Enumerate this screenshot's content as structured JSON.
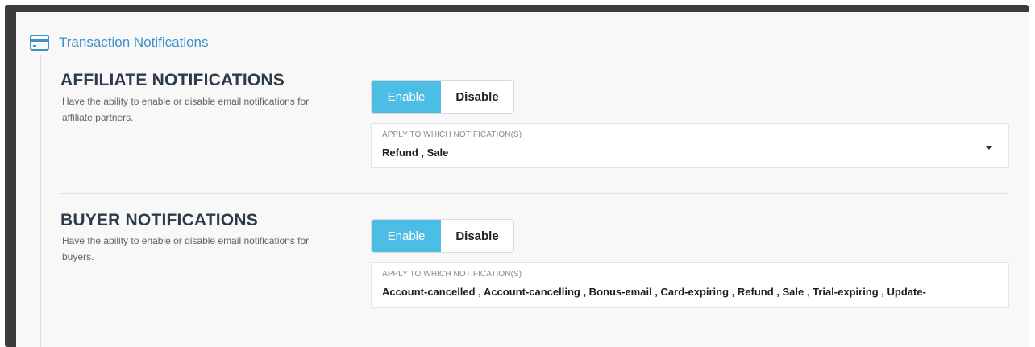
{
  "header": {
    "title": "Transaction Notifications",
    "icon": "credit-card-icon",
    "accent_color": "#3d92c9"
  },
  "sections": [
    {
      "title": "AFFILIATE NOTIFICATIONS",
      "description": "Have the ability to enable or disable email notifications for affiliate partners.",
      "toggle": {
        "enable_label": "Enable",
        "disable_label": "Disable",
        "selected": "Enable"
      },
      "select": {
        "label": "APPLY TO WHICH NOTIFICATION(S)",
        "value": "Refund , Sale"
      }
    },
    {
      "title": "BUYER NOTIFICATIONS",
      "description": "Have the ability to enable or disable email notifications for buyers.",
      "toggle": {
        "enable_label": "Enable",
        "disable_label": "Disable",
        "selected": "Enable"
      },
      "select": {
        "label": "APPLY TO WHICH NOTIFICATION(S)",
        "value": "Account-cancelled , Account-cancelling , Bonus-email , Card-expiring , Refund , Sale , Trial-expiring , Update-"
      }
    }
  ],
  "colors": {
    "enable_active": "#4cbde4",
    "title_text": "#2d3a4a"
  }
}
